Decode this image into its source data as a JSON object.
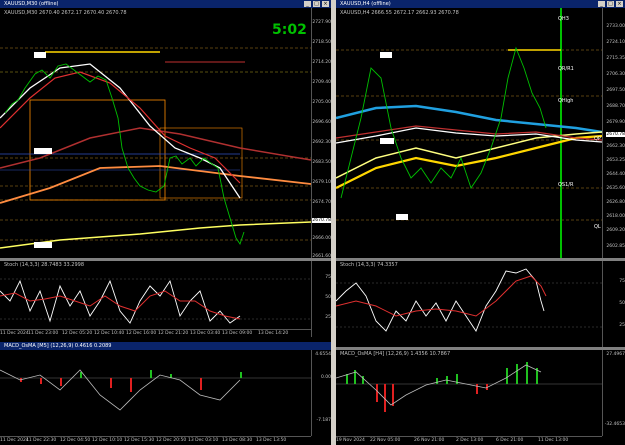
{
  "left_window": {
    "title": "XAUUSD,M30 (offline)",
    "info": "XAUUSD,M30 2670.40 2672.17 2670.40 2670.78",
    "clock": "5:02",
    "price_ticks": [
      "2727.90",
      "2718.50",
      "2714.20",
      "2709.40",
      "2705.00",
      "2696.60",
      "2692.30",
      "2683.50",
      "2679.10",
      "2674.70",
      "2670.78",
      "2666.00",
      "2661.60"
    ],
    "osc_label": "Stoch (14,3,3) 28.7483 33.2998",
    "osc_ticks": [
      "75",
      "50",
      "25"
    ],
    "macd_label": "MACD_OsMA [M5] (12,26,9) 0.4616 0.2089",
    "macd_ticks": [
      "4.6554",
      "0.00",
      "-7.187"
    ],
    "time_ticks": [
      "11 Dec 2024",
      "11 Dec 23:00",
      "12 Dec 05:20",
      "12 Dec 10:40",
      "12 Dec 16:00",
      "12 Dec 21:20",
      "13 Dec 03:40",
      "13 Dec 09:00",
      "13 Dec 14:20"
    ],
    "bottom_time_ticks": [
      "11 Dec 2024",
      "11 Dec 22:30",
      "12 Dec 04:50",
      "12 Dec 10:10",
      "12 Dec 15:30",
      "12 Dec 20:50",
      "13 Dec 03:10",
      "13 Dec 08:30",
      "13 Dec 13:50"
    ]
  },
  "right_window": {
    "title": "XAUUSD,H4 (offline)",
    "info": "XAUUSD,H4 2666.55 2672.17 2662.93 2670.78",
    "price_ticks": [
      "2733.00",
      "2724.10",
      "2715.35",
      "2706.30",
      "2697.50",
      "2688.70",
      "2679.90",
      "2670.78",
      "2662.30",
      "2653.25",
      "2644.40",
      "2635.60",
      "2626.80",
      "2618.00",
      "2609.20",
      "2602.85"
    ],
    "levels": [
      "QH3",
      "QR/R1",
      "QHigh",
      "QP",
      "QS1/R",
      "QL"
    ],
    "osc_label": "Stoch (14,3,3) 74.3357",
    "osc_ticks": [
      "75",
      "50",
      "25"
    ],
    "macd_label": "MACD_OsMA [H4] (12,26,9) 1.4356 10.7867",
    "macd_ticks": [
      "27.4967",
      "-32.4653"
    ],
    "time_ticks": [
      "19 Nov 2024",
      "22 Nov 05:00",
      "26 Nov 21:00",
      "2 Dec 13:00",
      "6 Dec 21:00",
      "11 Dec 13:00"
    ]
  }
}
